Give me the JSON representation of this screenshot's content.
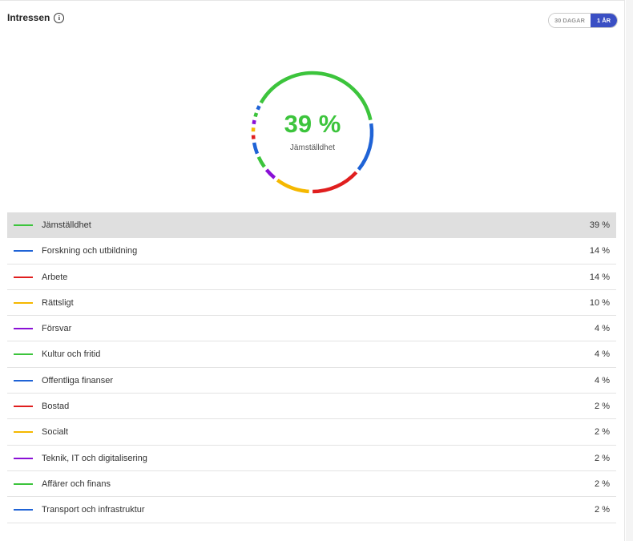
{
  "header": {
    "title": "Intressen",
    "info_icon": "info-icon"
  },
  "period_toggle": {
    "options": [
      "30 DAGAR",
      "1 ÅR"
    ],
    "selected": "1 ÅR"
  },
  "chart_data": {
    "type": "pie",
    "center_value": "39 %",
    "center_label": "Jämställdhet",
    "categories": [
      "Jämställdhet",
      "Forskning och utbildning",
      "Arbete",
      "Rättsligt",
      "Försvar",
      "Kultur och fritid",
      "Offentliga finanser",
      "Bostad",
      "Socialt",
      "Teknik, IT och digitalisering",
      "Affärer och finans",
      "Transport och infrastruktur"
    ],
    "values": [
      39,
      14,
      14,
      10,
      4,
      4,
      4,
      2,
      2,
      2,
      2,
      2
    ],
    "colors": [
      "#3cc43c",
      "#1f63d6",
      "#e01e1e",
      "#f5b800",
      "#8a10d6",
      "#3cc43c",
      "#1f63d6",
      "#e01e1e",
      "#f5b800",
      "#8a10d6",
      "#3cc43c",
      "#1f63d6"
    ]
  },
  "legend": {
    "selected_index": 0,
    "items": [
      {
        "label": "Jämställdhet",
        "value": "39 %",
        "color": "#3cc43c"
      },
      {
        "label": "Forskning och utbildning",
        "value": "14 %",
        "color": "#1f63d6"
      },
      {
        "label": "Arbete",
        "value": "14 %",
        "color": "#e01e1e"
      },
      {
        "label": "Rättsligt",
        "value": "10 %",
        "color": "#f5b800"
      },
      {
        "label": "Försvar",
        "value": "4 %",
        "color": "#8a10d6"
      },
      {
        "label": "Kultur och fritid",
        "value": "4 %",
        "color": "#3cc43c"
      },
      {
        "label": "Offentliga finanser",
        "value": "4 %",
        "color": "#1f63d6"
      },
      {
        "label": "Bostad",
        "value": "2 %",
        "color": "#e01e1e"
      },
      {
        "label": "Socialt",
        "value": "2 %",
        "color": "#f5b800"
      },
      {
        "label": "Teknik, IT och digitalisering",
        "value": "2 %",
        "color": "#8a10d6"
      },
      {
        "label": "Affärer och finans",
        "value": "2 %",
        "color": "#3cc43c"
      },
      {
        "label": "Transport och infrastruktur",
        "value": "2 %",
        "color": "#1f63d6"
      }
    ]
  }
}
